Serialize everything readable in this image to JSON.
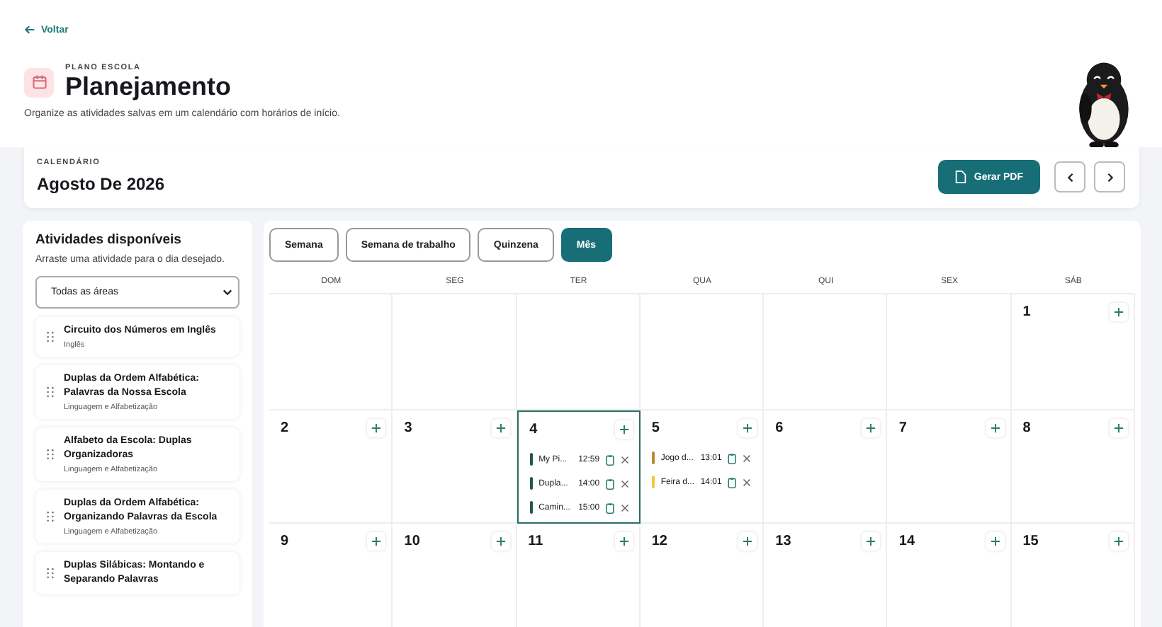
{
  "back_link": {
    "label": "Voltar"
  },
  "header": {
    "eyebrow": "PLANO ESCOLA",
    "title": "Planejamento",
    "subtitle": "Organize as atividades salvas em um calendário com horários de início."
  },
  "calendar_bar": {
    "eyebrow": "CALENDÁRIO",
    "month": "Agosto De 2026",
    "pdf_button": "Gerar PDF"
  },
  "sidebar": {
    "title": "Atividades disponíveis",
    "hint": "Arraste uma atividade para o dia desejado.",
    "filter": "Todas as áreas",
    "items": [
      {
        "title": "Circuito dos Números em Inglês",
        "area": "Inglês"
      },
      {
        "title": "Duplas da Ordem Alfabética: Palavras da Nossa Escola",
        "area": "Linguagem e Alfabetização"
      },
      {
        "title": "Alfabeto da Escola: Duplas Organizadoras",
        "area": "Linguagem e Alfabetização"
      },
      {
        "title": "Duplas da Ordem Alfabética: Organizando Palavras da Escola",
        "area": "Linguagem e Alfabetização"
      },
      {
        "title": "Duplas Silábicas: Montando e Separando Palavras"
      }
    ]
  },
  "view_tabs": [
    {
      "label": "Semana",
      "selected": false
    },
    {
      "label": "Semana de trabalho",
      "selected": false
    },
    {
      "label": "Quinzena",
      "selected": false
    },
    {
      "label": "Mês",
      "selected": true
    }
  ],
  "weekdays": [
    "DOM",
    "SEG",
    "TER",
    "QUA",
    "QUI",
    "SEX",
    "SÁB"
  ],
  "weeks": [
    [
      {
        "kind": "blank"
      },
      {
        "kind": "blank"
      },
      {
        "kind": "blank"
      },
      {
        "kind": "blank"
      },
      {
        "kind": "blank"
      },
      {
        "kind": "blank"
      },
      {
        "kind": "day",
        "number": "1",
        "selected": false
      }
    ],
    [
      {
        "kind": "day",
        "number": "2",
        "selected": false
      },
      {
        "kind": "day",
        "number": "3",
        "selected": false
      },
      {
        "kind": "day",
        "number": "4",
        "selected": true,
        "events": [
          {
            "title": "My Pi...",
            "time": "12:59",
            "color": "#1f5c48"
          },
          {
            "title": "Dupla...",
            "time": "14:00",
            "color": "#1f5c48"
          },
          {
            "title": "Camin...",
            "time": "15:00",
            "color": "#1f5c48"
          }
        ]
      },
      {
        "kind": "day",
        "number": "5",
        "selected": false,
        "events": [
          {
            "title": "Jogo d...",
            "time": "13:01",
            "color": "#b98a2e"
          },
          {
            "title": "Feira d...",
            "time": "14:01",
            "color": "#f0c93c"
          }
        ]
      },
      {
        "kind": "day",
        "number": "6",
        "selected": false
      },
      {
        "kind": "day",
        "number": "7",
        "selected": false
      },
      {
        "kind": "day",
        "number": "8",
        "selected": false
      }
    ],
    [
      {
        "kind": "day",
        "number": "9",
        "selected": false
      },
      {
        "kind": "day",
        "number": "10",
        "selected": false
      },
      {
        "kind": "day",
        "number": "11",
        "selected": false
      },
      {
        "kind": "day",
        "number": "12",
        "selected": false
      },
      {
        "kind": "day",
        "number": "13",
        "selected": false
      },
      {
        "kind": "day",
        "number": "14",
        "selected": false
      },
      {
        "kind": "day",
        "number": "15",
        "selected": false
      }
    ]
  ]
}
